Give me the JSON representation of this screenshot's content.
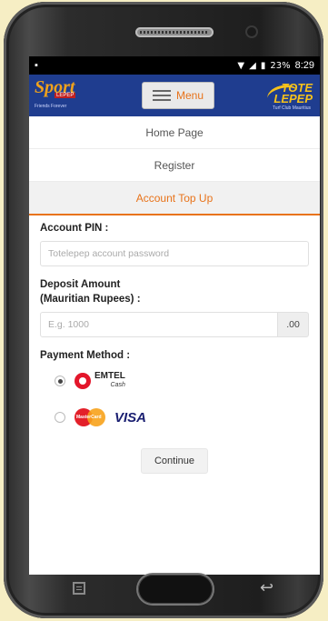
{
  "status_bar": {
    "notification_icon": "photo-icon",
    "wifi_icon": "wifi-icon",
    "signal_icon": "signal-icon",
    "battery_percent": "23%",
    "time": "8:29"
  },
  "header": {
    "left_logo": {
      "line1": "Sport",
      "line2": "LEPEP",
      "tagline": "Friends Forever"
    },
    "menu_label": "Menu",
    "right_logo": {
      "line1": "TOTE",
      "line2": "LEPEP",
      "tagline": "Turf Club Mauritius"
    }
  },
  "nav": {
    "items": [
      {
        "label": "Home Page"
      },
      {
        "label": "Register"
      },
      {
        "label": "Account Top Up"
      }
    ],
    "active_index": 2
  },
  "form": {
    "pin_label": "Account PIN :",
    "pin_placeholder": "Totelepep account password",
    "deposit_label_line1": "Deposit Amount",
    "deposit_label_line2": "(Mauritian Rupees) :",
    "deposit_placeholder": "E.g. 1000",
    "deposit_suffix": ".00",
    "payment_label": "Payment Method :",
    "payment_options": [
      {
        "name": "EMTEL",
        "sub": "Cash",
        "selected": true
      },
      {
        "brand1": "MasterCard",
        "brand2": "VISA",
        "selected": false
      }
    ],
    "continue_label": "Continue"
  },
  "colors": {
    "header_bg": "#1f3d8f",
    "accent": "#e8731a",
    "emtel_red": "#e3162b",
    "visa_blue": "#1a1f71"
  }
}
